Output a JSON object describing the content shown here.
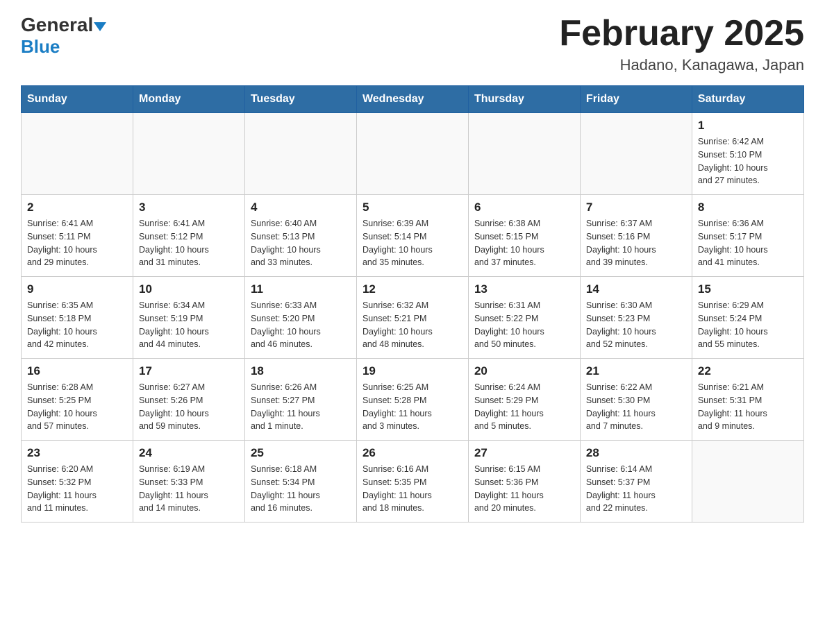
{
  "header": {
    "logo_general": "General",
    "logo_blue": "Blue",
    "month_year": "February 2025",
    "location": "Hadano, Kanagawa, Japan"
  },
  "calendar": {
    "days_of_week": [
      "Sunday",
      "Monday",
      "Tuesday",
      "Wednesday",
      "Thursday",
      "Friday",
      "Saturday"
    ],
    "weeks": [
      [
        {
          "day": "",
          "info": ""
        },
        {
          "day": "",
          "info": ""
        },
        {
          "day": "",
          "info": ""
        },
        {
          "day": "",
          "info": ""
        },
        {
          "day": "",
          "info": ""
        },
        {
          "day": "",
          "info": ""
        },
        {
          "day": "1",
          "info": "Sunrise: 6:42 AM\nSunset: 5:10 PM\nDaylight: 10 hours\nand 27 minutes."
        }
      ],
      [
        {
          "day": "2",
          "info": "Sunrise: 6:41 AM\nSunset: 5:11 PM\nDaylight: 10 hours\nand 29 minutes."
        },
        {
          "day": "3",
          "info": "Sunrise: 6:41 AM\nSunset: 5:12 PM\nDaylight: 10 hours\nand 31 minutes."
        },
        {
          "day": "4",
          "info": "Sunrise: 6:40 AM\nSunset: 5:13 PM\nDaylight: 10 hours\nand 33 minutes."
        },
        {
          "day": "5",
          "info": "Sunrise: 6:39 AM\nSunset: 5:14 PM\nDaylight: 10 hours\nand 35 minutes."
        },
        {
          "day": "6",
          "info": "Sunrise: 6:38 AM\nSunset: 5:15 PM\nDaylight: 10 hours\nand 37 minutes."
        },
        {
          "day": "7",
          "info": "Sunrise: 6:37 AM\nSunset: 5:16 PM\nDaylight: 10 hours\nand 39 minutes."
        },
        {
          "day": "8",
          "info": "Sunrise: 6:36 AM\nSunset: 5:17 PM\nDaylight: 10 hours\nand 41 minutes."
        }
      ],
      [
        {
          "day": "9",
          "info": "Sunrise: 6:35 AM\nSunset: 5:18 PM\nDaylight: 10 hours\nand 42 minutes."
        },
        {
          "day": "10",
          "info": "Sunrise: 6:34 AM\nSunset: 5:19 PM\nDaylight: 10 hours\nand 44 minutes."
        },
        {
          "day": "11",
          "info": "Sunrise: 6:33 AM\nSunset: 5:20 PM\nDaylight: 10 hours\nand 46 minutes."
        },
        {
          "day": "12",
          "info": "Sunrise: 6:32 AM\nSunset: 5:21 PM\nDaylight: 10 hours\nand 48 minutes."
        },
        {
          "day": "13",
          "info": "Sunrise: 6:31 AM\nSunset: 5:22 PM\nDaylight: 10 hours\nand 50 minutes."
        },
        {
          "day": "14",
          "info": "Sunrise: 6:30 AM\nSunset: 5:23 PM\nDaylight: 10 hours\nand 52 minutes."
        },
        {
          "day": "15",
          "info": "Sunrise: 6:29 AM\nSunset: 5:24 PM\nDaylight: 10 hours\nand 55 minutes."
        }
      ],
      [
        {
          "day": "16",
          "info": "Sunrise: 6:28 AM\nSunset: 5:25 PM\nDaylight: 10 hours\nand 57 minutes."
        },
        {
          "day": "17",
          "info": "Sunrise: 6:27 AM\nSunset: 5:26 PM\nDaylight: 10 hours\nand 59 minutes."
        },
        {
          "day": "18",
          "info": "Sunrise: 6:26 AM\nSunset: 5:27 PM\nDaylight: 11 hours\nand 1 minute."
        },
        {
          "day": "19",
          "info": "Sunrise: 6:25 AM\nSunset: 5:28 PM\nDaylight: 11 hours\nand 3 minutes."
        },
        {
          "day": "20",
          "info": "Sunrise: 6:24 AM\nSunset: 5:29 PM\nDaylight: 11 hours\nand 5 minutes."
        },
        {
          "day": "21",
          "info": "Sunrise: 6:22 AM\nSunset: 5:30 PM\nDaylight: 11 hours\nand 7 minutes."
        },
        {
          "day": "22",
          "info": "Sunrise: 6:21 AM\nSunset: 5:31 PM\nDaylight: 11 hours\nand 9 minutes."
        }
      ],
      [
        {
          "day": "23",
          "info": "Sunrise: 6:20 AM\nSunset: 5:32 PM\nDaylight: 11 hours\nand 11 minutes."
        },
        {
          "day": "24",
          "info": "Sunrise: 6:19 AM\nSunset: 5:33 PM\nDaylight: 11 hours\nand 14 minutes."
        },
        {
          "day": "25",
          "info": "Sunrise: 6:18 AM\nSunset: 5:34 PM\nDaylight: 11 hours\nand 16 minutes."
        },
        {
          "day": "26",
          "info": "Sunrise: 6:16 AM\nSunset: 5:35 PM\nDaylight: 11 hours\nand 18 minutes."
        },
        {
          "day": "27",
          "info": "Sunrise: 6:15 AM\nSunset: 5:36 PM\nDaylight: 11 hours\nand 20 minutes."
        },
        {
          "day": "28",
          "info": "Sunrise: 6:14 AM\nSunset: 5:37 PM\nDaylight: 11 hours\nand 22 minutes."
        },
        {
          "day": "",
          "info": ""
        }
      ]
    ]
  }
}
